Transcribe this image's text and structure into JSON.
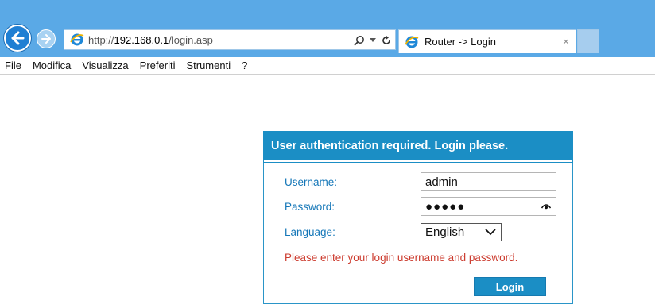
{
  "browser": {
    "url_prefix": "http://",
    "url_host": "192.168.0.1",
    "url_path": "/login.asp",
    "tab_title": "Router -> Login",
    "tab_close": "×",
    "menu": [
      "File",
      "Modifica",
      "Visualizza",
      "Preferiti",
      "Strumenti",
      "?"
    ],
    "icons": {
      "back": "back-arrow-icon",
      "forward": "forward-arrow-icon",
      "site": "ie-logo-icon",
      "search": "search-icon",
      "dropdown": "chevron-down-icon",
      "refresh": "refresh-icon"
    },
    "colors": {
      "chrome": "#5aa9e6",
      "back_button": "#1f7fd3"
    }
  },
  "login": {
    "header": "User authentication required. Login please.",
    "username_label": "Username:",
    "username_value": "admin",
    "password_label": "Password:",
    "password_masked": "●●●●●",
    "language_label": "Language:",
    "language_selected": "English",
    "message": "Please enter your login username and password.",
    "button_label": "Login",
    "colors": {
      "accent": "#1b8ec5",
      "label": "#1577b8",
      "error": "#cc3b2e"
    }
  }
}
